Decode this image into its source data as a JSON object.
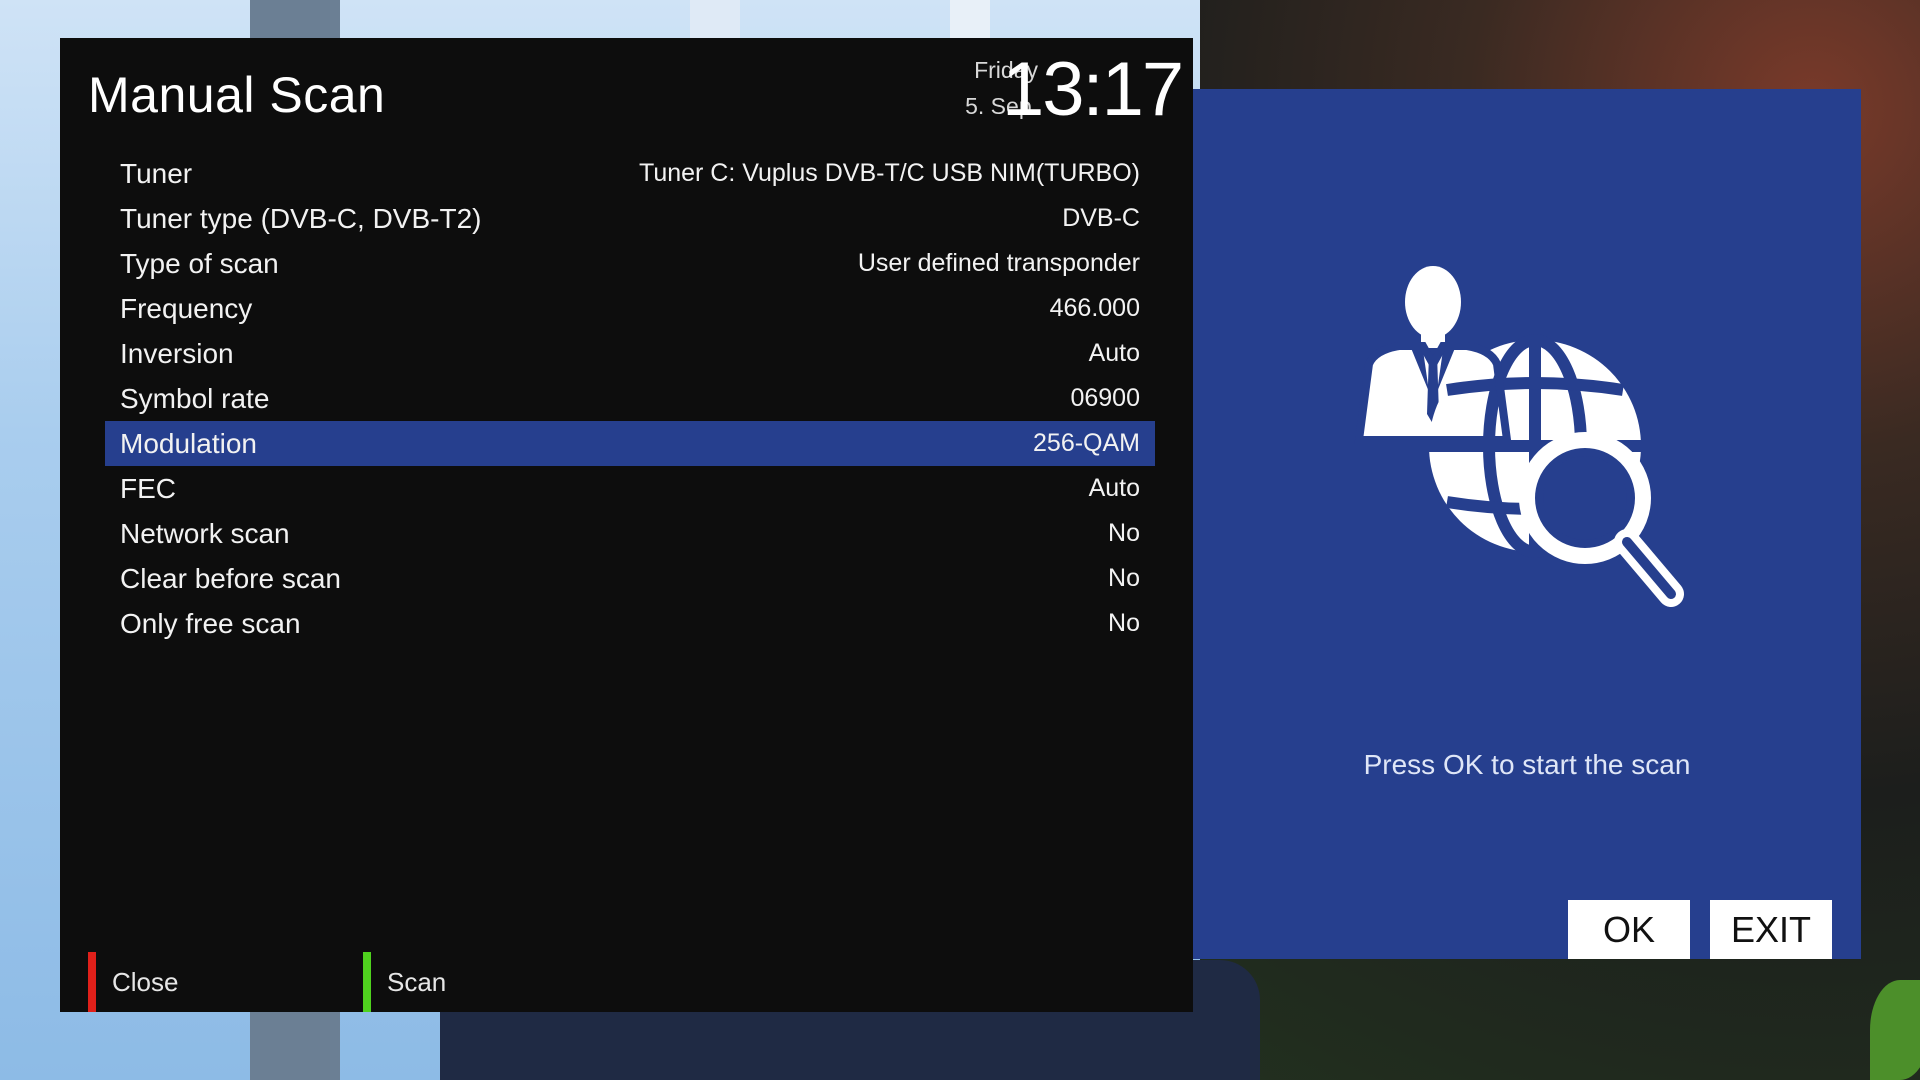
{
  "header": {
    "title": "Manual Scan",
    "weekday": "Friday",
    "date": "5. Sep.",
    "time": "13:17"
  },
  "settings": [
    {
      "label": "Tuner",
      "value": "Tuner C: Vuplus DVB-T/C USB NIM(TURBO)"
    },
    {
      "label": "Tuner type (DVB-C, DVB-T2)",
      "value": "DVB-C"
    },
    {
      "label": "Type of scan",
      "value": "User defined transponder"
    },
    {
      "label": "Frequency",
      "value": "466.000"
    },
    {
      "label": "Inversion",
      "value": "Auto"
    },
    {
      "label": "Symbol rate",
      "value": "06900"
    },
    {
      "label": "Modulation",
      "value": "256-QAM"
    },
    {
      "label": "FEC",
      "value": "Auto"
    },
    {
      "label": "Network scan",
      "value": "No"
    },
    {
      "label": "Clear before scan",
      "value": "No"
    },
    {
      "label": "Only free scan",
      "value": "No"
    }
  ],
  "selected_index": 6,
  "footer": {
    "red_label": "Close",
    "green_label": "Scan"
  },
  "info": {
    "icon": "user-globe-search-icon",
    "prompt": "Press OK to start the scan",
    "ok_label": "OK",
    "exit_label": "EXIT"
  },
  "colors": {
    "panel_bg": "#0d0d0d",
    "accent_blue": "#263f8e",
    "red_key": "#e0201a",
    "green_key": "#4fd21e"
  }
}
